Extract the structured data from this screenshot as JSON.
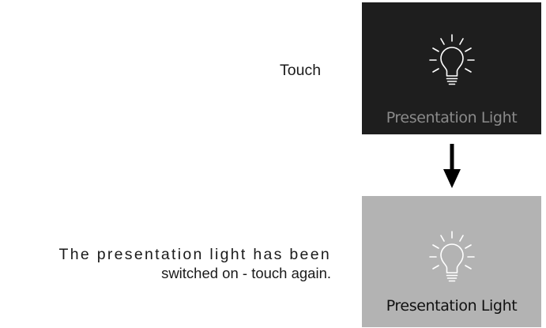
{
  "steps": {
    "touch_caption": "Touch",
    "result_caption_line1": "The presentation light has been",
    "result_caption_line2": "switched on - touch again."
  },
  "tile_off": {
    "label": "Presentation Light",
    "state": "off",
    "icon": "lightbulb-icon"
  },
  "tile_on": {
    "label": "Presentation Light",
    "state": "on",
    "icon": "lightbulb-icon"
  },
  "transition": {
    "icon": "arrow-down-icon"
  },
  "colors": {
    "tile_off_bg": "#1e1e1e",
    "tile_off_label": "#8a8a8a",
    "tile_on_bg": "#b3b3b3",
    "tile_on_label": "#111111",
    "icon_stroke": "#ffffff"
  }
}
